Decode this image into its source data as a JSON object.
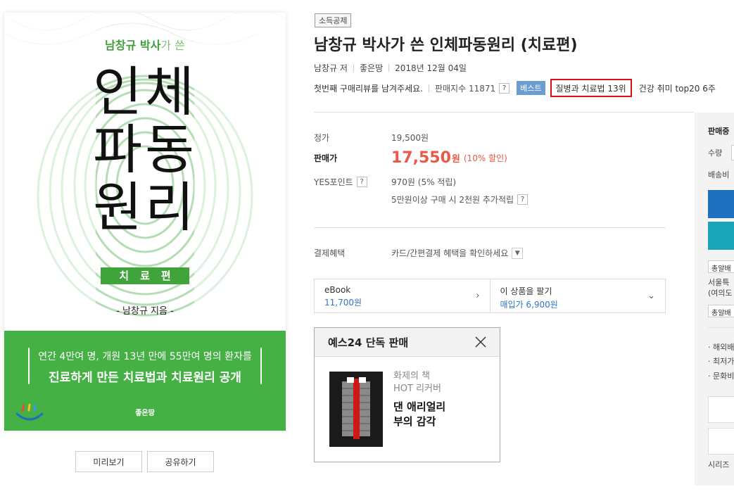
{
  "cover": {
    "author_name": "남창규 박사",
    "author_suffix": "가 쓴",
    "title_line1": "인체",
    "title_line2": "파동",
    "title_line3": "원리",
    "subtitle": "치료편",
    "writer": "- 남창규 지음 -",
    "tagline1": "연간 4만여 명, 개원 13년 만에 55만여 명의 환자를",
    "tagline2": "진료하게 만든 치료법과 치료원리 공개",
    "publisher": "좋은땅",
    "green": "#45b043",
    "preview_label": "미리보기",
    "share_label": "공유하기"
  },
  "product": {
    "tag": "소득공제",
    "title": "남창규 박사가 쓴 인체파동원리 (치료편)",
    "author": "남창규 저",
    "publisher": "좋은땅",
    "date": "2018년 12월 04일",
    "review_prompt": "첫번째 구매리뷰를 남겨주세요.",
    "sales_index": "판매지수 11871",
    "help": "?",
    "best_label": "베스트",
    "rank_highlight": "질병과 치료법 13위",
    "rank_extra": "건강 취미 top20 6주",
    "highlight_color": "#d70f17"
  },
  "price": {
    "list_label": "정가",
    "list_value": "19,500원",
    "sale_label": "판매가",
    "sale_value": "17,550",
    "sale_unit": "원",
    "discount": "(10% 할인)",
    "points_label": "YES포인트",
    "points_value": "970원 (5% 적립)",
    "points_extra": "5만원이상 구매 시 2천원 추가적립",
    "benefit_label": "결제혜택",
    "benefit_value": "카드/간편결제 혜택을 확인하세요",
    "accent": "#e85a48"
  },
  "ebook": {
    "label": "eBook",
    "price": "11,700원",
    "sell_label": "이 상품을 팔기",
    "sell_price": "매입가 6,900원"
  },
  "popup": {
    "title": "예스24 단독 판매",
    "line1": "화제의 책",
    "line2": "HOT 리커버",
    "book_title1": "댄 애리얼리",
    "book_title2": "부의 감각"
  },
  "side": {
    "status": "판매중",
    "qty_label": "수량",
    "ship_label": "배송비",
    "btn_blue": "#1e6fc0",
    "btn_teal": "#1aa5b8",
    "chip1": "총알배",
    "addr1": "서울특",
    "addr2": "(여의도",
    "chip2": "총알배",
    "bullet1": "· 해외배",
    "bullet2": "· 최저가",
    "bullet3": "· 문화비",
    "series": "시리즈"
  }
}
